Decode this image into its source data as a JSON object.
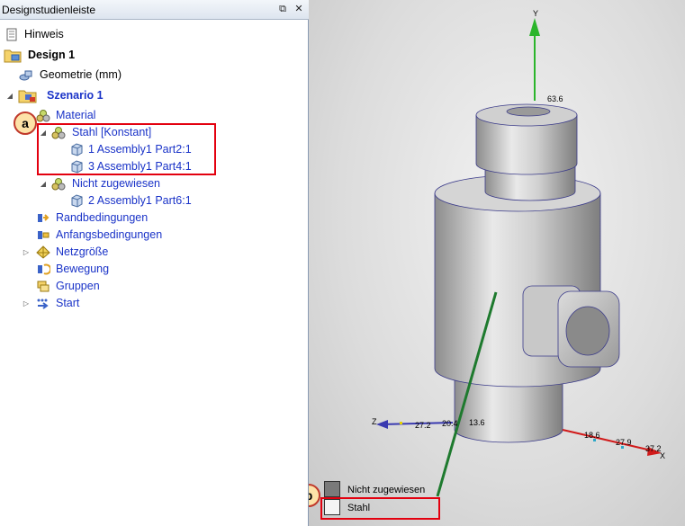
{
  "panel": {
    "title": "Designstudienleiste",
    "tree": {
      "hinweis": "Hinweis",
      "design": "Design 1",
      "geometrie": "Geometrie (mm)",
      "szenario": "Szenario 1",
      "material": "Material",
      "stahl": "Stahl [Konstant]",
      "part1": "1 Assembly1  Part2:1",
      "part3": "3 Assembly1  Part4:1",
      "nicht": "Nicht zugewiesen",
      "part2": "2 Assembly1  Part6:1",
      "rand": "Randbedingungen",
      "anfang": "Anfangsbedingungen",
      "netz": "Netzgröße",
      "bewegung": "Bewegung",
      "gruppen": "Gruppen",
      "start": "Start"
    }
  },
  "viewport": {
    "axes": {
      "y_label": "Y",
      "z_label": "Z",
      "x_label": "X",
      "y_tick": "63.6",
      "z_ticks": [
        "27.2",
        "20.4",
        "13.6"
      ],
      "x_ticks": [
        "18.6",
        "27.9",
        "37.2"
      ]
    },
    "legend": {
      "items": [
        {
          "label": "Nicht zugewiesen",
          "color": "#7a7a7a"
        },
        {
          "label": "Stahl",
          "color": "#f4f4f4"
        }
      ]
    }
  },
  "annotations": {
    "a": "a",
    "b": "b"
  },
  "colors": {
    "highlight_border": "#e3000f",
    "tree_link": "#1a33c8",
    "y_axis": "#2bb52b",
    "x_axis": "#d11a1a",
    "z_axis": "#3a3ab0"
  }
}
